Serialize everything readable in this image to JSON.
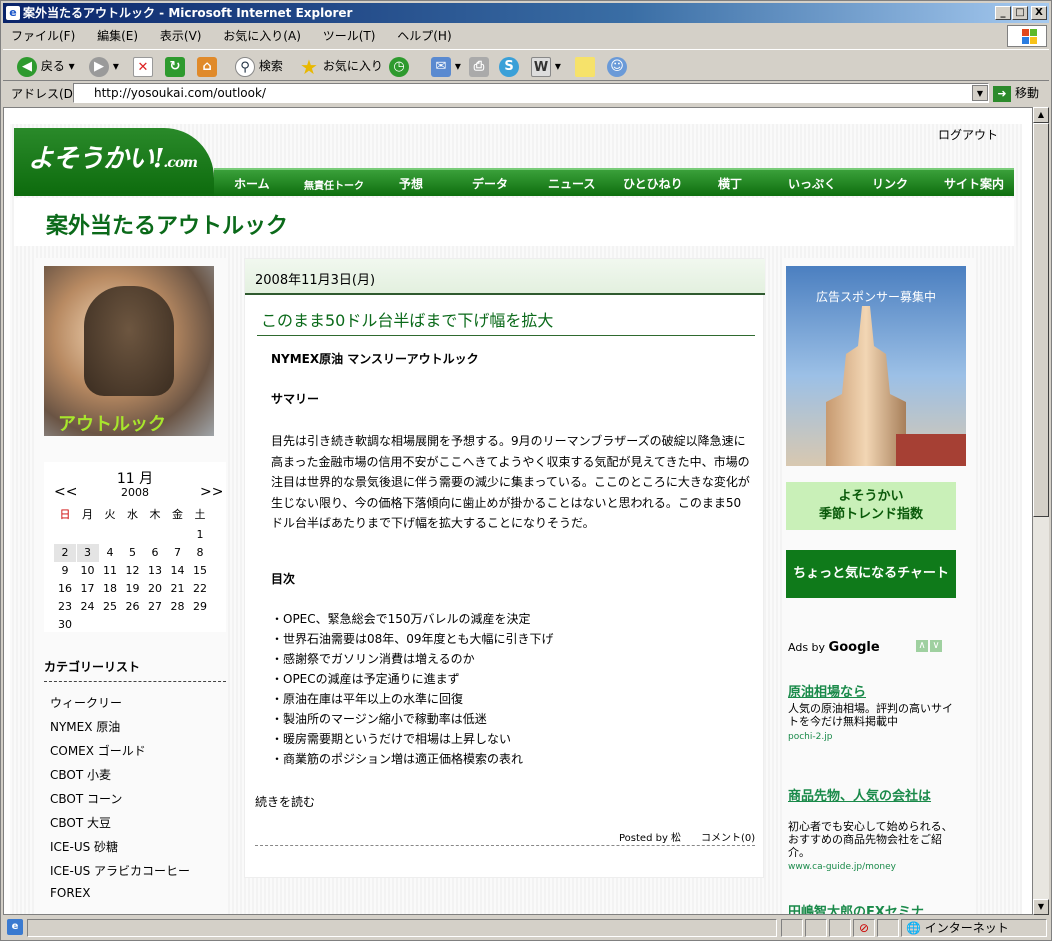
{
  "window": {
    "title": "案外当たるアウトルック - Microsoft Internet Explorer",
    "min": "_",
    "max": "□",
    "close": "X"
  },
  "menu": [
    "ファイル(F)",
    "編集(E)",
    "表示(V)",
    "お気に入り(A)",
    "ツール(T)",
    "ヘルプ(H)"
  ],
  "toolbar": {
    "back": "戻る",
    "search": "検索",
    "favorites": "お気に入り"
  },
  "address": {
    "label": "アドレス(D)",
    "url": "http://yosoukai.com/outlook/",
    "go": "移動"
  },
  "status": {
    "zone": "インターネット"
  },
  "site": {
    "logout": "ログアウト",
    "logo": "よそうかい!",
    "logo_suffix": ".com",
    "nav": [
      "ホーム",
      "無責任トーク",
      "予想",
      "データ",
      "ニュース",
      "ひとひねり",
      "横丁",
      "いっぷく",
      "リンク",
      "サイト案内"
    ],
    "page_title": "案外当たるアウトルック"
  },
  "left": {
    "photo_label": "アウトルック",
    "calendar": {
      "month": "11 月",
      "year": "2008",
      "prev": "<<",
      "next": ">>",
      "weekdays": [
        "日",
        "月",
        "火",
        "水",
        "木",
        "金",
        "土"
      ],
      "days": [
        "",
        "",
        "",
        "",
        "",
        "",
        "1",
        "2",
        "3",
        "4",
        "5",
        "6",
        "7",
        "8",
        "9",
        "10",
        "11",
        "12",
        "13",
        "14",
        "15",
        "16",
        "17",
        "18",
        "19",
        "20",
        "21",
        "22",
        "23",
        "24",
        "25",
        "26",
        "27",
        "28",
        "29",
        "30"
      ]
    },
    "category_title": "カテゴリーリスト",
    "categories": [
      "ウィークリー",
      "NYMEX 原油",
      "COMEX ゴールド",
      "CBOT 小麦",
      "CBOT コーン",
      "CBOT 大豆",
      "ICE-US 砂糖",
      "ICE-US アラビカコーヒー",
      "FOREX"
    ]
  },
  "post": {
    "date": "2008年11月3日(月)",
    "title": "このまま50ドル台半ばまで下げ幅を拡大",
    "heading": "NYMEX原油 マンスリーアウトルック",
    "summary_label": "サマリー",
    "summary": "目先は引き続き軟調な相場展開を予想する。9月のリーマンブラザーズの破綻以降急速に高まった金融市場の信用不安がここへきてようやく収束する気配が見えてきた中、市場の注目は世界的な景気後退に伴う需要の減少に集まっている。ここのところに大きな変化が生じない限り、今の価格下落傾向に歯止めが掛かることはないと思われる。このまま50ドル台半ばあたりまで下げ幅を拡大することになりそうだ。",
    "toc_label": "目次",
    "toc": [
      "・OPEC、緊急総会で150万バレルの減産を決定",
      "・世界石油需要は08年、09年度とも大幅に引き下げ",
      "・感謝祭でガソリン消費は増えるのか",
      "・OPECの減産は予定通りに進まず",
      "・原油在庫は平年以上の水準に回復",
      "・製油所のマージン縮小で稼動率は低迷",
      "・暖房需要期というだけで相場は上昇しない",
      "・商業筋のポジション増は適正価格模索の表れ"
    ],
    "read_more": "続きを読む",
    "posted_by": "Posted by 松",
    "comments": "コメント(0)"
  },
  "right": {
    "sponsor": "広告スポンサー募集中",
    "btn1_line1": "よそうかい",
    "btn1_line2": "季節トレンド指数",
    "btn2": "ちょっと気になるチャート",
    "ads_by": "Ads by",
    "google": "Google",
    "ads": [
      {
        "title": "原油相場なら",
        "body": "人気の原油相場。評判の高いサイトを今だけ無料掲載中",
        "url": "pochi-2.jp"
      },
      {
        "title": "商品先物、人気の会社は",
        "body": "初心者でも安心して始められる、おすすめの商品先物会社をご紹介。",
        "url": "www.ca-guide.jp/money"
      },
      {
        "title": "田嶋智太郎のFXセミナ",
        "body": "",
        "url": ""
      }
    ]
  },
  "colors": {
    "brand_green": "#0f7a1a",
    "title_green": "#0b6a1a",
    "link_green": "#1a8a4a"
  }
}
